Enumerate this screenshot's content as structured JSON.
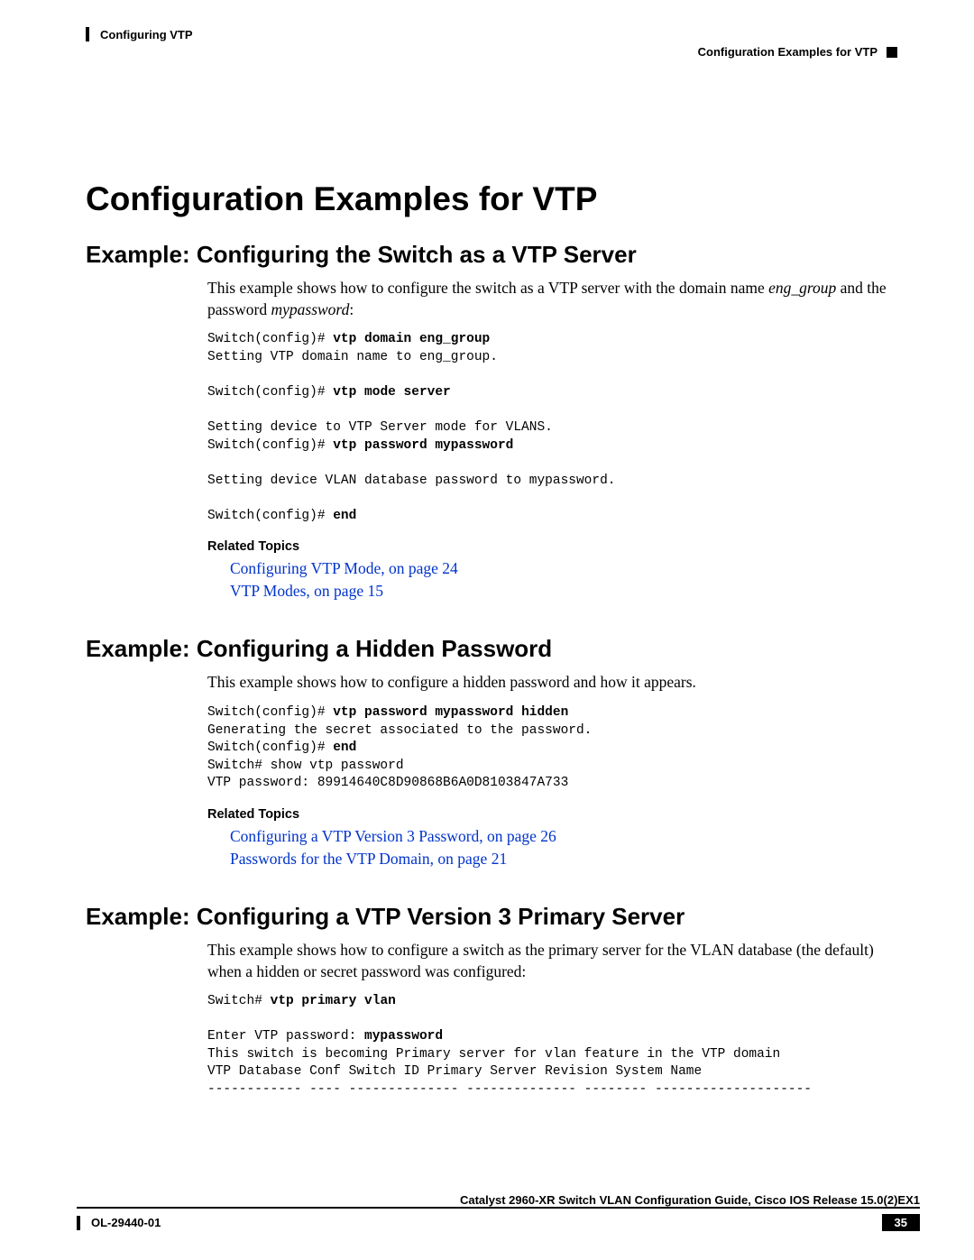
{
  "header": {
    "top_left": "Configuring VTP",
    "top_right": "Configuration Examples for VTP"
  },
  "main": {
    "h1": "Configuration Examples for VTP",
    "section1": {
      "h2": "Example: Configuring the Switch as a VTP Server",
      "para_pre": "This example shows how to configure the switch as a VTP server with the domain name ",
      "para_italic1": "eng_group",
      "para_mid": " and the password ",
      "para_italic2": "mypassword",
      "para_post": ":",
      "code_l1a": "Switch(config)# ",
      "code_l1b": "vtp domain eng_group",
      "code_l2": "Setting VTP domain name to eng_group.",
      "code_l3a": "Switch(config)# ",
      "code_l3b": "vtp mode server",
      "code_l4": "Setting device to VTP Server mode for VLANS.",
      "code_l5a": "Switch(config)# ",
      "code_l5b": "vtp password mypassword",
      "code_l6": "Setting device VLAN database password to mypassword.",
      "code_l7a": "Switch(config)# ",
      "code_l7b": "end",
      "related": "Related Topics",
      "link1": "Configuring VTP Mode,  on page 24",
      "link2": "VTP Modes,  on page 15"
    },
    "section2": {
      "h2": "Example: Configuring a Hidden Password",
      "para": "This example shows how to configure a hidden password and how it appears.",
      "code_l1a": "Switch(config)# ",
      "code_l1b": "vtp password mypassword hidden",
      "code_l2": "Generating the secret associated to the password.",
      "code_l3a": "Switch(config)# ",
      "code_l3b": "end",
      "code_l4": "Switch# show vtp password",
      "code_l5": "VTP password: 89914640C8D90868B6A0D8103847A733",
      "related": "Related Topics",
      "link1": "Configuring a VTP Version 3 Password,  on page 26",
      "link2": "Passwords for the VTP Domain,  on page 21"
    },
    "section3": {
      "h2": "Example: Configuring a VTP Version 3 Primary Server",
      "para": "This example shows how to configure a switch as the primary server for the VLAN database (the default) when a hidden or secret password was configured:",
      "code_l1a": "Switch# ",
      "code_l1b": "vtp primary vlan",
      "code_l2a": "Enter VTP password:",
      "code_l2b": " mypassword",
      "code_l3": "This switch is becoming Primary server for vlan feature in the VTP domain",
      "code_l4": "VTP Database Conf Switch ID Primary Server Revision System Name",
      "code_l5": "------------ ---- -------------- -------------- -------- --------------------"
    }
  },
  "footer": {
    "guide_title": "Catalyst 2960-XR Switch VLAN Configuration Guide, Cisco IOS Release 15.0(2)EX1",
    "doc_id": "OL-29440-01",
    "page_num": "35"
  }
}
